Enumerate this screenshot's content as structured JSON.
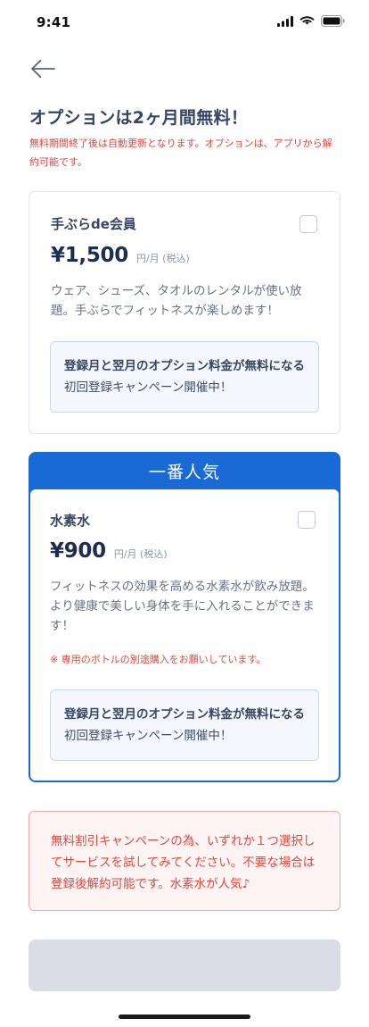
{
  "status_bar": {
    "time": "9:41"
  },
  "header": {
    "title": "オプションは2ヶ月間無料！",
    "note": "無料期間終了後は自動更新となります。オプションは、アプリから解約可能です。"
  },
  "options": [
    {
      "name": "手ぶらde会員",
      "price": "¥1,500",
      "unit": "円/月 (税込)",
      "description": "ウェア、シューズ、タオルのレンタルが使い放題。手ぶらでフィットネスが楽しめます！",
      "campaign_bold": "登録月と翌月のオプション料金が無料になる",
      "campaign_rest": "初回登録キャンペーン開催中！",
      "checked": false
    },
    {
      "badge": "一番人気",
      "name": "水素水",
      "price": "¥900",
      "unit": "円/月 (税込)",
      "description": "フィットネスの効果を高める水素水が飲み放題。より健康で美しい身体を手に入れることができます！",
      "note": "※ 専用のボトルの別途購入をお願いしています。",
      "campaign_bold": "登録月と翌月のオプション料金が無料になる",
      "campaign_rest": "初回登録キャンペーン開催中！",
      "checked": false
    }
  ],
  "promo": {
    "text": "無料割引キャンペーンの為、いずれか１つ選択してサービスを試してみてください。不要な場合は登録後解約可能です。水素水が人気♪"
  },
  "submit": {
    "label": ""
  },
  "colors": {
    "accent": "#1a6ad6",
    "warning": "#e0473f",
    "disabled": "#dadde5"
  }
}
